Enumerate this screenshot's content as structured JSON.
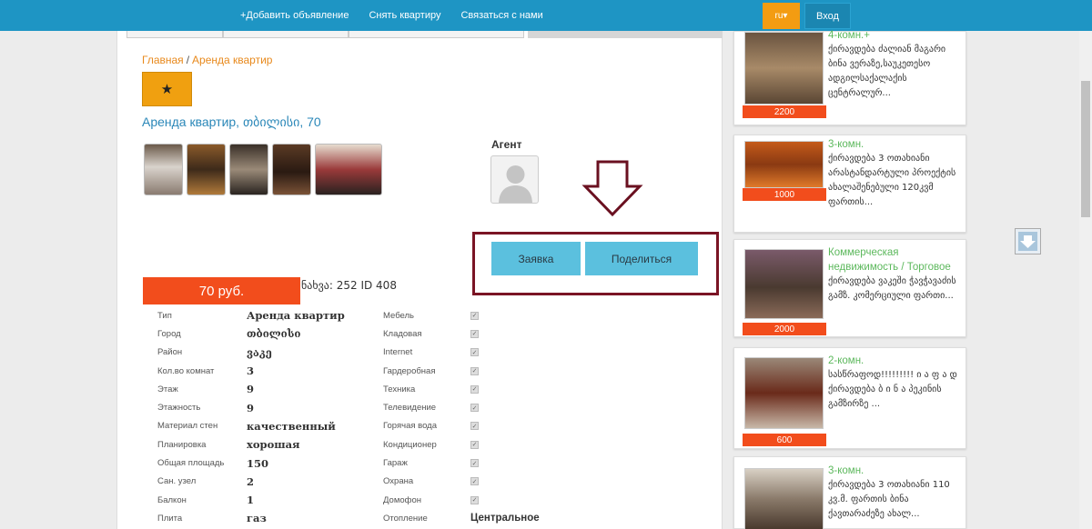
{
  "topnav": {
    "links": [
      "+Добавить объявление",
      "Снять квартиру",
      "Связаться с нами"
    ],
    "lang": "ru▾",
    "login": "Вход"
  },
  "breadcrumb": {
    "home": "Главная",
    "sep": "/",
    "current": "Аренда квартир"
  },
  "star": "★",
  "listing": {
    "title": "Аренда квартир, თბილისი, 70",
    "agent_label": "Агент",
    "price": "70 руб.",
    "views_id": "ნახვა: 252 ID 408",
    "apply_label": "Заявка",
    "share_label": "Поделиться"
  },
  "properties": [
    {
      "label": "Тип",
      "value": "Аренда квартир"
    },
    {
      "label": "Город",
      "value": "თბილისი"
    },
    {
      "label": "Район",
      "value": "ვაკე"
    },
    {
      "label": "Кол.во комнат",
      "value": "3"
    },
    {
      "label": "Этаж",
      "value": "9"
    },
    {
      "label": "Этажность",
      "value": "9"
    },
    {
      "label": "Материал стен",
      "value": "качественный"
    },
    {
      "label": "Планировка",
      "value": "хорошая"
    },
    {
      "label": "Общая площадь",
      "value": "150"
    },
    {
      "label": "Сан. узел",
      "value": "2"
    },
    {
      "label": "Балкон",
      "value": "1"
    },
    {
      "label": "Плита",
      "value": "газ"
    }
  ],
  "amenities": [
    {
      "label": "Мебель",
      "check": "✓"
    },
    {
      "label": "Кладовая",
      "check": "✓"
    },
    {
      "label": "Internet",
      "check": "✓"
    },
    {
      "label": "Гардеробная",
      "check": "✓"
    },
    {
      "label": "Техника",
      "check": "✓"
    },
    {
      "label": "Телевидение",
      "check": "✓"
    },
    {
      "label": "Горячая вода",
      "check": "✓"
    },
    {
      "label": "Кондиционер",
      "check": "✓"
    },
    {
      "label": "Гараж",
      "check": "✓"
    },
    {
      "label": "Охрана",
      "check": "✓"
    },
    {
      "label": "Домофон",
      "check": "✓"
    }
  ],
  "heating": {
    "label": "Отопление",
    "value": "Центральное"
  },
  "sidebar_cards": [
    {
      "type": "4-комн.+",
      "desc": "ქირავდება ძალიან მაგარი ბინა ვერაზე,საუკეთესო ადგილსაქალაქის ცენტრალურ...",
      "price": "2200"
    },
    {
      "type": "3-комн.",
      "desc": "ქირავდება 3 ოთახიანი არასტანდარტული პროექტის ახალაშენებული 120კვმ ფართის...",
      "price": "1000"
    },
    {
      "type": "Коммерческая недвижимость / Торговое",
      "desc": "ქირავდება ვაკეში ჭავჭავაძის გამზ. კომერციული ფართი...",
      "price": "2000"
    },
    {
      "type": "2-комн.",
      "desc": "სასწრაფოდ!!!!!!!!! ი ა ფ ა დ ქირავდება ბ ი ნ ა პეკინის გამზირზე ...",
      "price": "600"
    },
    {
      "type": "3-комн.",
      "desc": "ქირავდება 3 ოთახიანი 110 კვ.მ. ფართის ბინა ქავთარაძეზე ახალ...",
      "price": ""
    }
  ],
  "colors": {
    "topbar": "#1e95c4",
    "accent_orange": "#f0a010",
    "price_red": "#f24d1c",
    "button_blue": "#5bc0de",
    "link_blue": "#2a87b8",
    "card_green": "#5cb85c",
    "highlight": "#7a1424"
  }
}
